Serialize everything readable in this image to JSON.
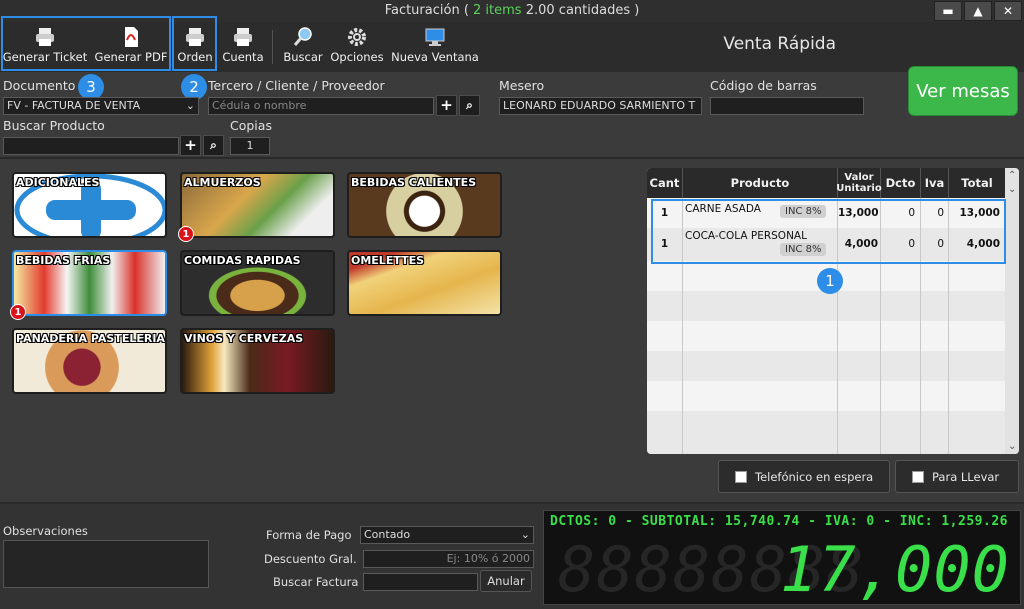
{
  "window": {
    "title_prefix": "Facturación (",
    "items": "2 items",
    "title_suffix": "2.00 cantidades )",
    "buttons": [
      "▬",
      "▲",
      "✕"
    ]
  },
  "toolbar": {
    "generar_ticket": "Generar Ticket",
    "generar_pdf": "Generar PDF",
    "orden": "Orden",
    "cuenta": "Cuenta",
    "buscar": "Buscar",
    "opciones": "Opciones",
    "nueva_ventana": "Nueva Ventana",
    "venta_rapida": "Venta Rápida"
  },
  "callouts": {
    "c1": "1",
    "c2": "2",
    "c3": "3"
  },
  "form": {
    "documento_label": "Documento",
    "documento_value": "FV - FACTURA DE VENTA",
    "tercero_label": "Tercero / Cliente / Proveedor",
    "tercero_placeholder": "Cédula o nombre",
    "mesero_label": "Mesero",
    "mesero_value": "LEONARD EDUARDO SARMIENTO T",
    "codigo_label": "Código de barras",
    "codigo_value": "",
    "buscar_producto_label": "Buscar Producto",
    "buscar_producto_value": "",
    "copias_label": "Copias",
    "copias_value": "1",
    "ver_mesas": "Ver mesas"
  },
  "categories": [
    {
      "name": "ADICIONALES",
      "badge": ""
    },
    {
      "name": "ALMUERZOS",
      "badge": "1"
    },
    {
      "name": "BEBIDAS CALIENTES",
      "badge": ""
    },
    {
      "name": "BEBIDAS FRIAS",
      "badge": "1"
    },
    {
      "name": "COMIDAS RAPIDAS",
      "badge": ""
    },
    {
      "name": "OMELETTES",
      "badge": ""
    },
    {
      "name": "PANADERIA PASTELERIA",
      "badge": ""
    },
    {
      "name": "VINOS Y CERVEZAS",
      "badge": ""
    }
  ],
  "table": {
    "headers": {
      "cant": "Cant",
      "producto": "Producto",
      "valor_1": "Valor",
      "valor_2": "Unitario",
      "dcto": "Dcto",
      "iva": "Iva",
      "total": "Total"
    },
    "rows": [
      {
        "cant": "1",
        "producto": "CARNE ASADA",
        "tag": "INC 8%",
        "valor": "13,000",
        "dcto": "0",
        "iva": "0",
        "total": "13,000"
      },
      {
        "cant": "1",
        "producto": "COCA-COLA PERSONAL",
        "tag": "INC 8%",
        "valor": "4,000",
        "dcto": "0",
        "iva": "0",
        "total": "4,000"
      }
    ]
  },
  "actions": {
    "telefonico": "Telefónico en espera",
    "para_llevar": "Para LLevar"
  },
  "bottom": {
    "observaciones_label": "Observaciones",
    "forma_pago_label": "Forma de Pago",
    "forma_pago_value": "Contado",
    "descuento_label": "Descuento Gral.",
    "descuento_placeholder": "Ej: 10% ó 2000",
    "buscar_factura_label": "Buscar Factura",
    "anular": "Anular"
  },
  "display": {
    "summary": "DCTOS: 0 - SUBTOTAL: 15,740.74 - IVA: 0 - INC: 1,259.26",
    "total": "17,000",
    "ghost": "88888888"
  }
}
